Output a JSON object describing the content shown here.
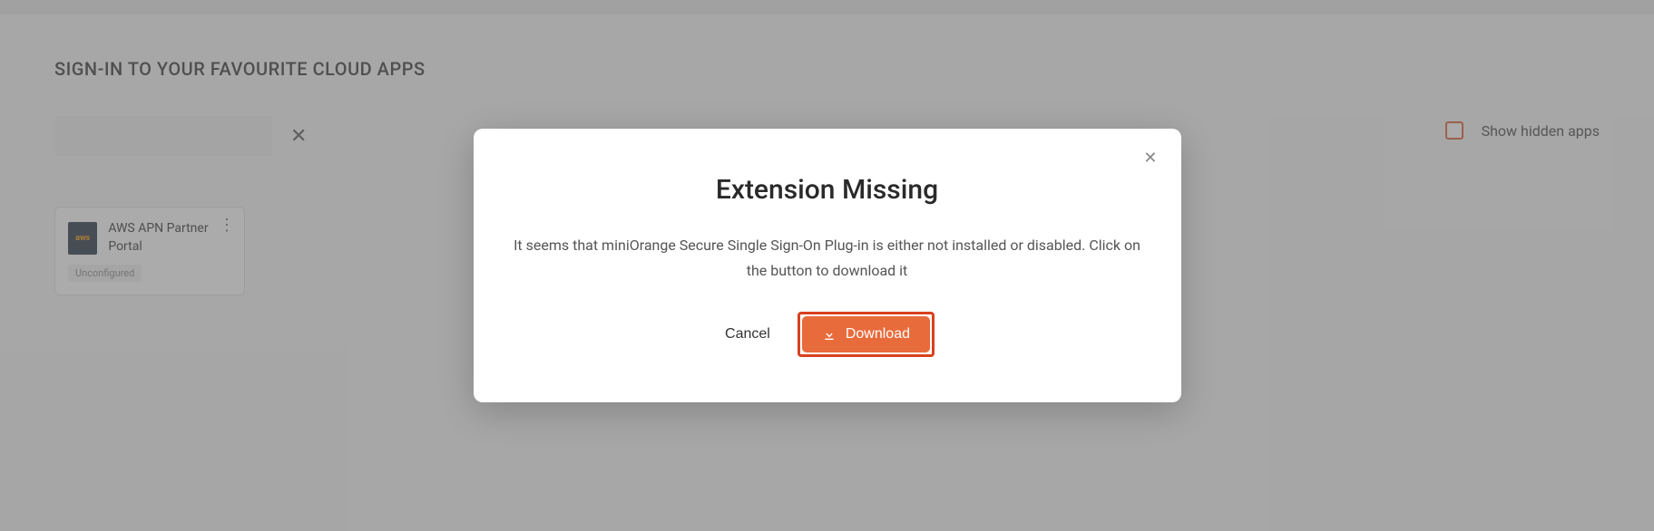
{
  "page": {
    "title": "SIGN-IN TO YOUR FAVOURITE CLOUD APPS"
  },
  "search": {
    "placeholder": "",
    "value": ""
  },
  "controls": {
    "show_hidden_label": "Show hidden apps",
    "show_hidden_checked": false
  },
  "app_card": {
    "icon_text": "aws",
    "name": "AWS APN Partner Portal",
    "status": "Unconfigured"
  },
  "modal": {
    "title": "Extension Missing",
    "message": "It seems that miniOrange Secure Single Sign-On Plug-in is either not installed or disabled. Click on the button to download it",
    "cancel_label": "Cancel",
    "download_label": "Download"
  }
}
